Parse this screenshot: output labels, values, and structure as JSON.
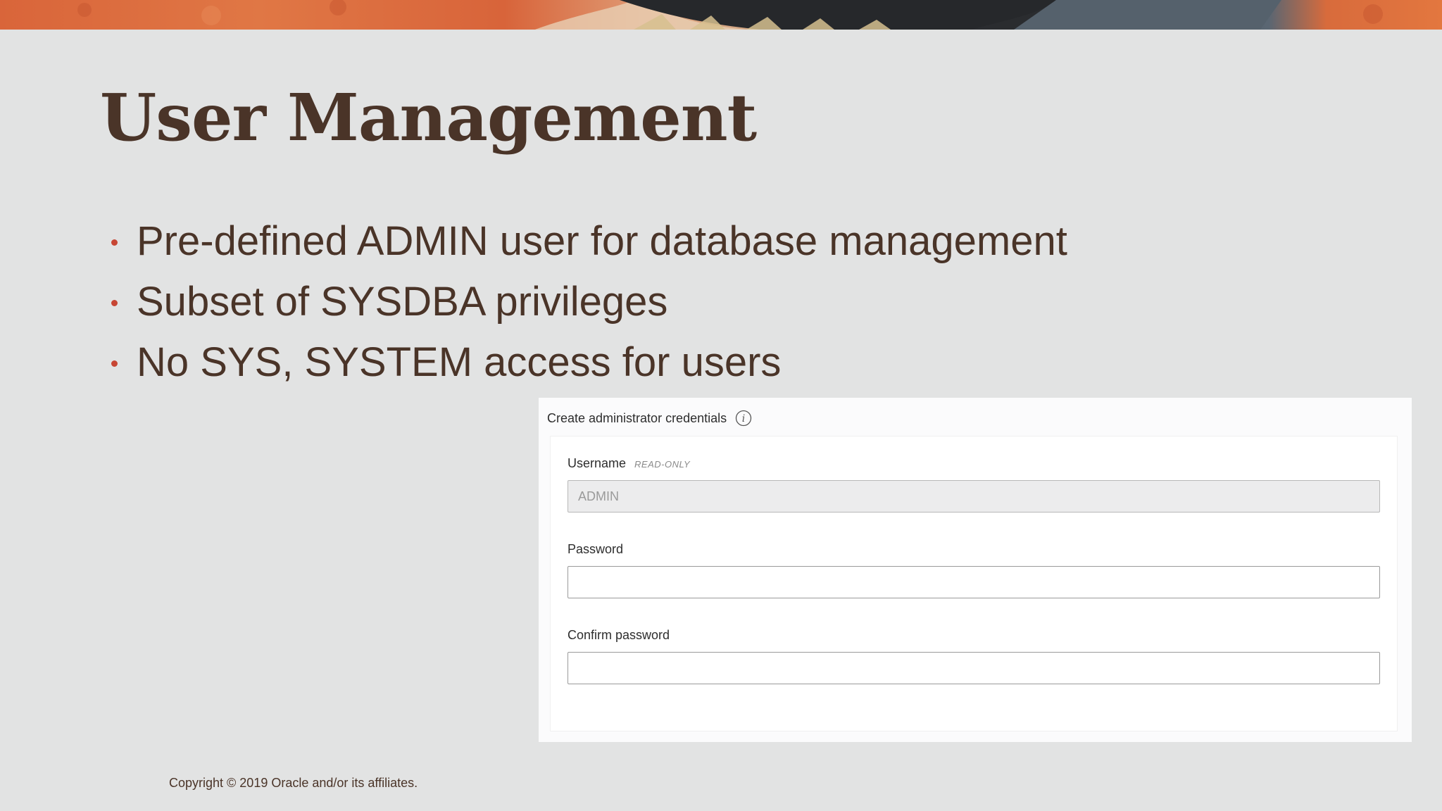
{
  "slide": {
    "title": "User Management",
    "bullets": [
      "Pre-defined ADMIN user for database management",
      "Subset of SYSDBA privileges",
      "No SYS, SYSTEM access for users"
    ],
    "footer": "Copyright © 2019 Oracle and/or its affiliates."
  },
  "credentials_panel": {
    "header": "Create administrator credentials",
    "info_icon": "info-icon",
    "username": {
      "label": "Username",
      "tag": "READ-ONLY",
      "value": "ADMIN"
    },
    "password": {
      "label": "Password",
      "value": ""
    },
    "confirm_password": {
      "label": "Confirm password",
      "value": ""
    }
  },
  "colors": {
    "background": "#e2e3e3",
    "title_text": "#4a3428",
    "bullet_dot": "#c74634",
    "banner_orange": "#d9653a"
  }
}
